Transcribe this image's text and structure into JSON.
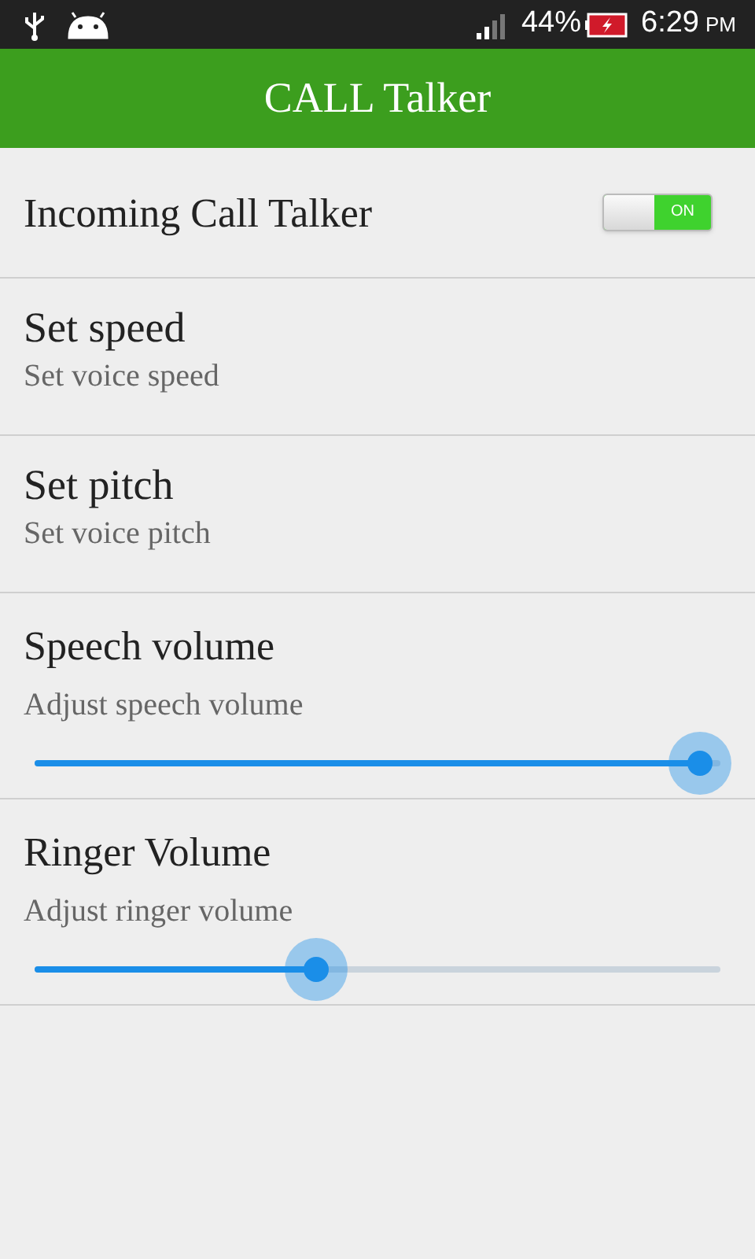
{
  "status_bar": {
    "battery": "44%",
    "time": "6:29",
    "ampm": "PM"
  },
  "header": {
    "title": "CALL Talker"
  },
  "settings": [
    {
      "kind": "toggle",
      "title": "Incoming Call Talker",
      "toggle": {
        "on": true,
        "label": "ON"
      }
    },
    {
      "kind": "text",
      "title": "Set speed",
      "subtitle": "Set voice speed"
    },
    {
      "kind": "text",
      "title": "Set pitch",
      "subtitle": "Set voice pitch"
    },
    {
      "kind": "slider",
      "title": "Speech volume",
      "subtitle": "Adjust speech volume",
      "level": 0.97
    },
    {
      "kind": "slider",
      "title": "Ringer Volume",
      "subtitle": "Adjust ringer volume",
      "level": 0.41
    }
  ]
}
